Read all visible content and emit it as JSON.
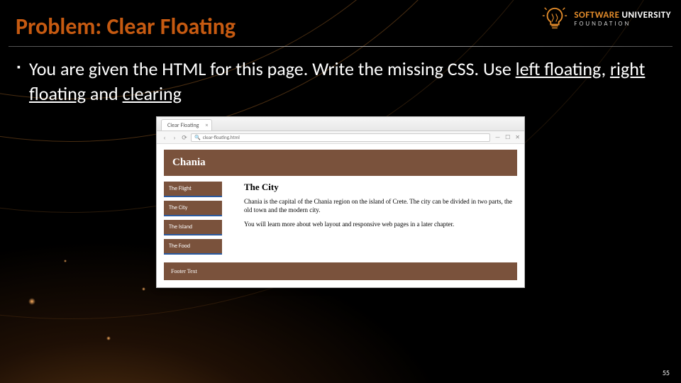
{
  "slide": {
    "title": "Problem: Clear Floating",
    "bullet_full": "You are given the HTML for this page. Write the missing CSS. Use left floating, right floating and clearing",
    "page_number": "55"
  },
  "keywords": {
    "left_floating": "left floating",
    "right_floating": "right floating",
    "clearing": "clearing"
  },
  "logo": {
    "line1": "SOFTWARE",
    "line2": "UNIVERSITY",
    "line3": "FOUNDATION"
  },
  "browser": {
    "tab_title": "Clear Floating",
    "url_display": "clear-floating.html"
  },
  "example_page": {
    "header": "Chania",
    "nav": [
      "The Flight",
      "The City",
      "The Island",
      "The Food"
    ],
    "main_heading": "The City",
    "para1": "Chania is the capital of the Chania region on the island of Crete. The city can be divided in two parts, the old town and the modern city.",
    "para2": "You will learn more about web layout and responsive web pages in a later chapter.",
    "footer": "Footer Text"
  }
}
